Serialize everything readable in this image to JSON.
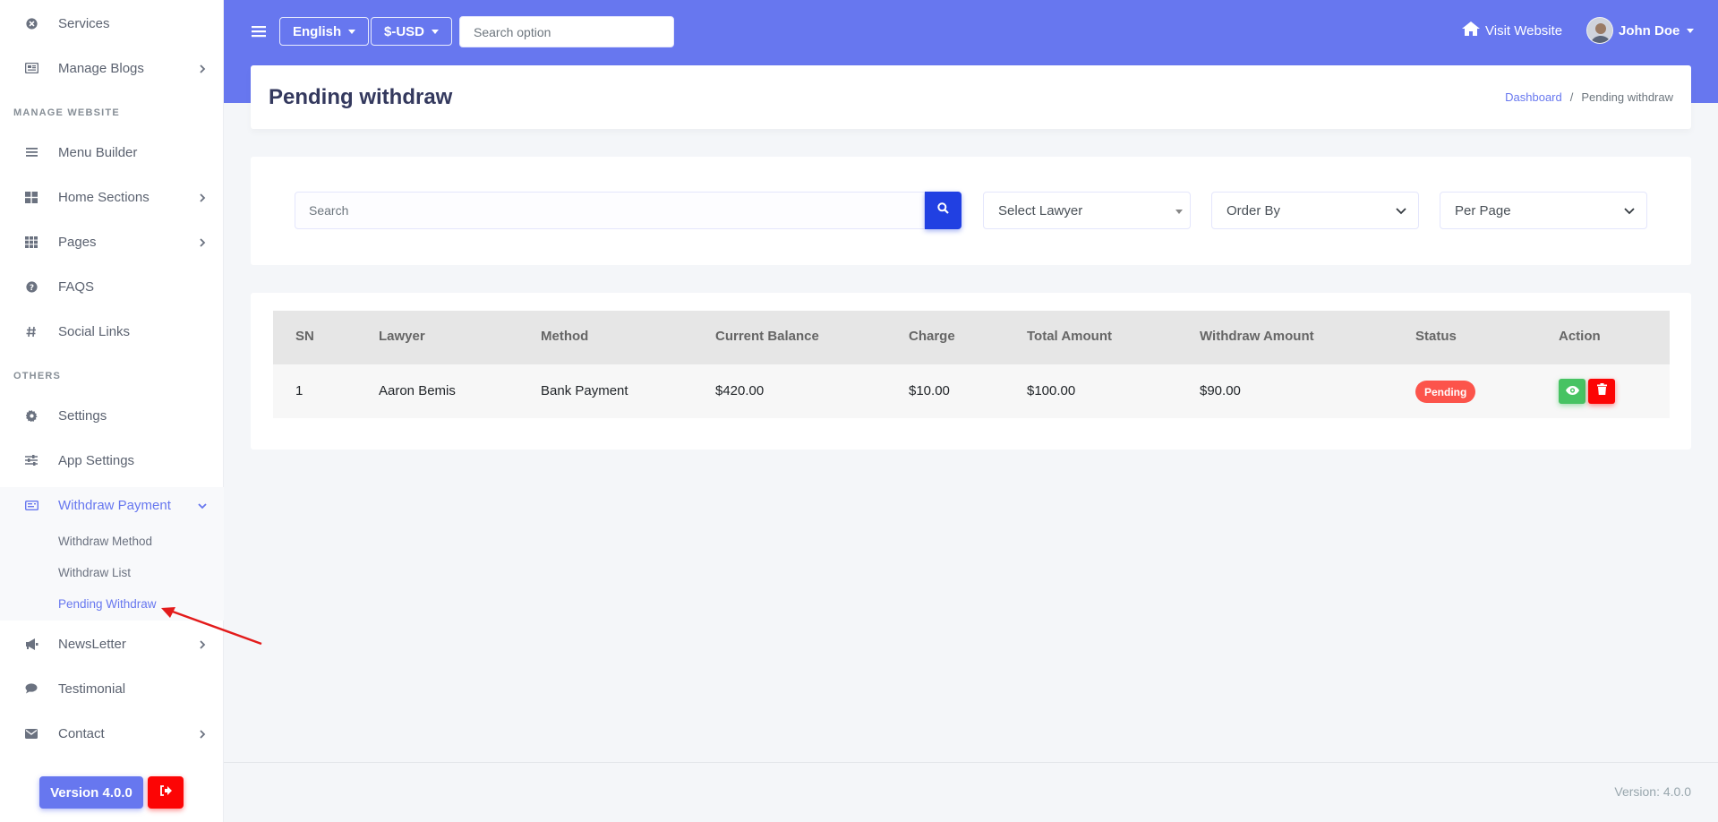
{
  "colors": {
    "primary": "#6777ef",
    "danger": "#fc0505",
    "success": "#47c363",
    "search_button": "#2140e2",
    "pending_badge": "#fc544b",
    "annotation_arrow": "#e31b1b"
  },
  "sidebar": {
    "items_top": [
      {
        "label": "Services",
        "icon": "times-circle-icon"
      },
      {
        "label": "Manage Blogs",
        "icon": "newspaper-icon",
        "has_submenu": true
      }
    ],
    "header_manage": "MANAGE WEBSITE",
    "items_manage": [
      {
        "label": "Menu Builder",
        "icon": "bars-icon"
      },
      {
        "label": "Home Sections",
        "icon": "th-large-icon",
        "has_submenu": true
      },
      {
        "label": "Pages",
        "icon": "th-icon",
        "has_submenu": true
      },
      {
        "label": "FAQS",
        "icon": "question-circle-icon"
      },
      {
        "label": "Social Links",
        "icon": "hashtag-icon"
      }
    ],
    "header_others": "OTHERS",
    "items_others": [
      {
        "label": "Settings",
        "icon": "cog-icon"
      },
      {
        "label": "App Settings",
        "icon": "sliders-icon"
      },
      {
        "label": "Withdraw Payment",
        "icon": "money-check-icon",
        "expanded": true
      }
    ],
    "withdraw_submenu": [
      "Withdraw Method",
      "Withdraw List",
      "Pending Withdraw"
    ],
    "items_bottom": [
      {
        "label": "NewsLetter",
        "icon": "bullhorn-icon",
        "has_submenu": true
      },
      {
        "label": "Testimonial",
        "icon": "comment-icon"
      },
      {
        "label": "Contact",
        "icon": "envelope-icon",
        "has_submenu": true
      }
    ],
    "version_label": "Version 4.0.0"
  },
  "topbar": {
    "language": "English",
    "currency": "$-USD",
    "search_placeholder": "Search option",
    "visit_label": "Visit Website",
    "user_name": "John Doe"
  },
  "page": {
    "title": "Pending withdraw",
    "breadcrumb_home": "Dashboard",
    "breadcrumb_current": "Pending withdraw"
  },
  "filters": {
    "search_placeholder": "Search",
    "lawyer_select": "Select Lawyer",
    "order_select": "Order By",
    "per_page_select": "Per Page"
  },
  "table": {
    "headers": [
      "SN",
      "Lawyer",
      "Method",
      "Current Balance",
      "Charge",
      "Total Amount",
      "Withdraw Amount",
      "Status",
      "Action"
    ],
    "rows": [
      {
        "sn": "1",
        "lawyer": "Aaron Bemis",
        "method": "Bank Payment",
        "current_balance": "$420.00",
        "charge": "$10.00",
        "total_amount": "$100.00",
        "withdraw_amount": "$90.00",
        "status": "Pending"
      }
    ]
  },
  "footer": {
    "version_text": "Version: 4.0.0"
  }
}
